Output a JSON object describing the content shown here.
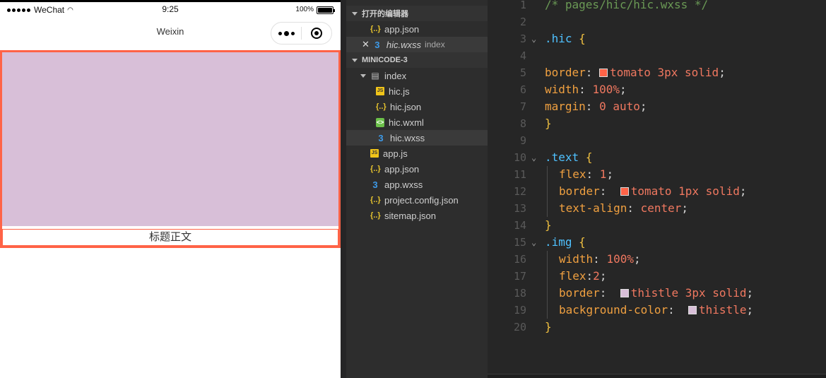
{
  "phone": {
    "carrier": "WeChat",
    "time": "9:25",
    "battery": "100%",
    "nav_title": "Weixin",
    "content_text": "标题正文"
  },
  "explorer": {
    "open_editors_header": "打开的编辑器",
    "open_editors": [
      {
        "name": "app.json",
        "type": "json"
      },
      {
        "name": "hic.wxss",
        "type": "css",
        "suffix": "index"
      }
    ],
    "project_header": "MINICODE-3",
    "folder": "index",
    "folder_files": [
      {
        "name": "hic.js",
        "type": "js"
      },
      {
        "name": "hic.json",
        "type": "json"
      },
      {
        "name": "hic.wxml",
        "type": "wxml"
      },
      {
        "name": "hic.wxss",
        "type": "css"
      }
    ],
    "root_files": [
      {
        "name": "app.js",
        "type": "js"
      },
      {
        "name": "app.json",
        "type": "json"
      },
      {
        "name": "app.wxss",
        "type": "css"
      },
      {
        "name": "project.config.json",
        "type": "json"
      },
      {
        "name": "sitemap.json",
        "type": "json"
      }
    ]
  },
  "editor": {
    "lines": [
      {
        "n": "1",
        "parts": [
          [
            "c-comment",
            "/* pages/hic/hic.wxss */"
          ]
        ]
      },
      {
        "n": "2",
        "parts": []
      },
      {
        "n": "3",
        "fold": true,
        "parts": [
          [
            "c-sel",
            ".hic"
          ],
          [
            "c-punc",
            " "
          ],
          [
            "c-brace",
            "{"
          ]
        ]
      },
      {
        "n": "4",
        "parts": []
      },
      {
        "n": "5",
        "parts": [
          [
            "c-prop",
            "border"
          ],
          [
            "c-punc",
            ": "
          ],
          [
            "swatch",
            "tomato"
          ],
          [
            "c-val",
            "tomato 3px solid"
          ],
          [
            "c-punc",
            ";"
          ]
        ]
      },
      {
        "n": "6",
        "parts": [
          [
            "c-prop",
            "width"
          ],
          [
            "c-punc",
            ": "
          ],
          [
            "c-num",
            "100%"
          ],
          [
            "c-punc",
            ";"
          ]
        ]
      },
      {
        "n": "7",
        "parts": [
          [
            "c-prop",
            "margin"
          ],
          [
            "c-punc",
            ": "
          ],
          [
            "c-num",
            "0 auto"
          ],
          [
            "c-punc",
            ";"
          ]
        ]
      },
      {
        "n": "8",
        "parts": [
          [
            "c-brace",
            "}"
          ]
        ]
      },
      {
        "n": "9",
        "parts": []
      },
      {
        "n": "10",
        "fold": true,
        "parts": [
          [
            "c-sel",
            ".text"
          ],
          [
            "c-punc",
            " "
          ],
          [
            "c-brace",
            "{"
          ]
        ]
      },
      {
        "n": "11",
        "indent": true,
        "parts": [
          [
            "c-prop",
            "flex"
          ],
          [
            "c-punc",
            ": "
          ],
          [
            "c-num",
            "1"
          ],
          [
            "c-punc",
            ";"
          ]
        ]
      },
      {
        "n": "12",
        "indent": true,
        "parts": [
          [
            "c-prop",
            "border"
          ],
          [
            "c-punc",
            ":  "
          ],
          [
            "swatch",
            "tomato"
          ],
          [
            "c-val",
            "tomato 1px solid"
          ],
          [
            "c-punc",
            ";"
          ]
        ]
      },
      {
        "n": "13",
        "indent": true,
        "parts": [
          [
            "c-prop",
            "text-align"
          ],
          [
            "c-punc",
            ": "
          ],
          [
            "c-val",
            "center"
          ],
          [
            "c-punc",
            ";"
          ]
        ]
      },
      {
        "n": "14",
        "parts": [
          [
            "c-brace",
            "}"
          ]
        ]
      },
      {
        "n": "15",
        "fold": true,
        "parts": [
          [
            "c-sel",
            ".img"
          ],
          [
            "c-punc",
            " "
          ],
          [
            "c-brace",
            "{"
          ]
        ]
      },
      {
        "n": "16",
        "indent": true,
        "parts": [
          [
            "c-prop",
            "width"
          ],
          [
            "c-punc",
            ": "
          ],
          [
            "c-num",
            "100%"
          ],
          [
            "c-punc",
            ";"
          ]
        ]
      },
      {
        "n": "17",
        "indent": true,
        "parts": [
          [
            "c-prop",
            "flex"
          ],
          [
            "c-punc",
            ":"
          ],
          [
            "c-num",
            "2"
          ],
          [
            "c-punc",
            ";"
          ]
        ]
      },
      {
        "n": "18",
        "indent": true,
        "parts": [
          [
            "c-prop",
            "border"
          ],
          [
            "c-punc",
            ":  "
          ],
          [
            "swatch",
            "thistle"
          ],
          [
            "c-val",
            "thistle 3px solid"
          ],
          [
            "c-punc",
            ";"
          ]
        ]
      },
      {
        "n": "19",
        "indent": true,
        "parts": [
          [
            "c-prop",
            "background-color"
          ],
          [
            "c-punc",
            ":  "
          ],
          [
            "swatch",
            "thistle"
          ],
          [
            "c-val",
            "thistle"
          ],
          [
            "c-punc",
            ";"
          ]
        ]
      },
      {
        "n": "20",
        "parts": [
          [
            "c-brace",
            "}"
          ]
        ]
      }
    ]
  },
  "colors": {
    "tomato": "#ff6347",
    "thistle": "#d8bfd8",
    "editor_bg": "#262626",
    "explorer_bg": "#2d2d2d"
  }
}
